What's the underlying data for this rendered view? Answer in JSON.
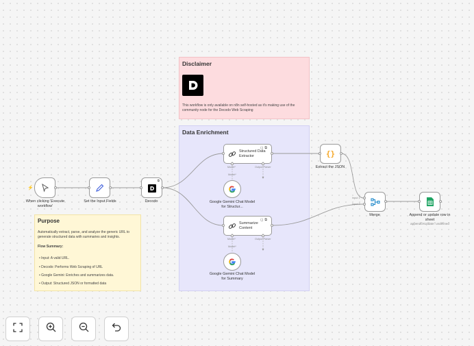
{
  "canvas": {
    "stickies": {
      "disclaimer": {
        "title": "Disclaimer",
        "text": "This workflow is only available on n8n self-hosted as it's making use of the community node for the Decodo Web Scraping"
      },
      "enrichment": {
        "title": "Data Enrichment"
      },
      "purpose": {
        "title": "Purpose",
        "intro": "Automatically extract, parse, and analyze the generic URL to generate structured data with summaries and insights.",
        "flow_title": "Flow Summary:",
        "items": [
          "Input: A valid URL.",
          "Decodo: Performs Web Scraping of URL",
          "Google Gemini: Enriches and summarizes data.",
          "Output: Structured JSON or formatted data"
        ]
      }
    },
    "nodes": {
      "trigger": {
        "label": "When clicking 'Execute workflow'",
        "icon": "cursor-icon"
      },
      "set_fields": {
        "label": "Set the Input Fields",
        "icon": "pencil-icon"
      },
      "decodo": {
        "label": "Decodo",
        "icon": "decodo-logo-icon"
      },
      "extractor": {
        "label": "Structured Data Extractor",
        "icon": "link-icon"
      },
      "gemini1": {
        "label": "Google Gemini Chat Model for Structur...",
        "icon": "google-icon"
      },
      "summarize": {
        "label": "Summarize Content",
        "icon": "link-icon"
      },
      "gemini2": {
        "label": "Google Gemini Chat Model for Summary",
        "icon": "google-icon"
      },
      "extract_json": {
        "label": "Extract the JSON",
        "icon": "braces-icon"
      },
      "merge": {
        "label": "Merge",
        "icon": "merge-icon"
      },
      "sheets": {
        "label": "Append or update row in sheet",
        "sublabel": "appendOrUpdate: undefined",
        "icon": "sheets-icon"
      }
    },
    "ports": {
      "model": "Model*",
      "output_parser": "Output Parser",
      "input1": "Input 1",
      "input2": "Input 2"
    }
  },
  "controls": {
    "fit_view": "fit-view-icon",
    "zoom_in": "zoom-in-icon",
    "zoom_out": "zoom-out-icon",
    "undo": "undo-icon"
  },
  "colors": {
    "disclaimer_bg": "#fddcdf",
    "enrichment_bg": "#e7e6fb",
    "purpose_bg": "#fff7d6",
    "trigger_accent": "#ff6d5a",
    "sheets_green": "#1fa463",
    "json_orange": "#f5a623",
    "set_blue": "#3b5bdb"
  }
}
